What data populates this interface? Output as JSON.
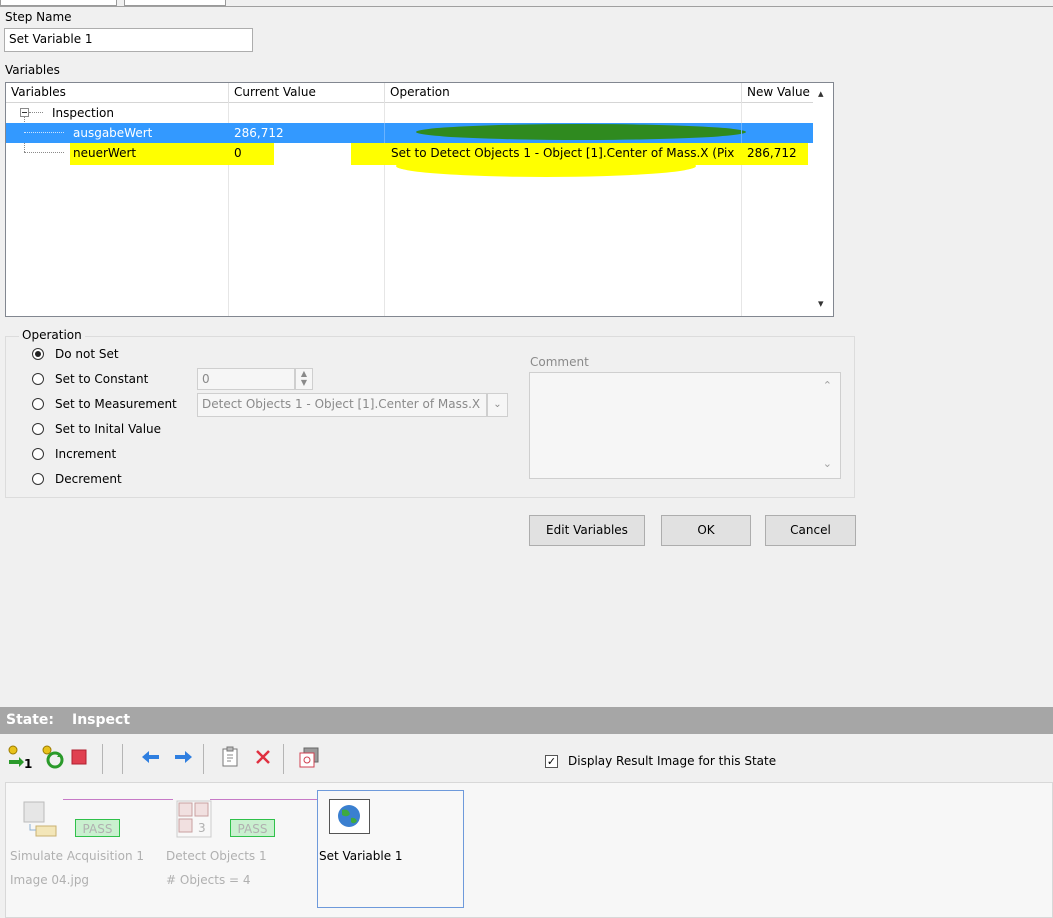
{
  "step_name": {
    "label": "Step Name",
    "value": "Set Variable 1"
  },
  "variables": {
    "label": "Variables",
    "columns": [
      "Variables",
      "Current Value",
      "Operation",
      "New Value"
    ],
    "group": "Inspection",
    "rows": [
      {
        "name": "ausgabeWert",
        "current": "286,712",
        "operation": "",
        "new_value": ""
      },
      {
        "name": "neuerWert",
        "current": "0",
        "operation": "Set to Detect Objects 1 - Object [1].Center of Mass.X (Pix",
        "new_value": "286,712"
      }
    ]
  },
  "operation": {
    "label": "Operation",
    "options": [
      "Do not Set",
      "Set to Constant",
      "Set to Measurement",
      "Set to Inital Value",
      "Increment",
      "Decrement"
    ],
    "selected_index": 0,
    "constant_value": "0",
    "measurement_value": "Detect Objects 1 - Object [1].Center of Mass.X",
    "comment_label": "Comment"
  },
  "buttons": {
    "edit_variables": "Edit Variables",
    "ok": "OK",
    "cancel": "Cancel"
  },
  "state": {
    "label": "State:",
    "name": "Inspect",
    "display_result_label": "Display Result Image for this State",
    "display_result_checked": true
  },
  "steps": [
    {
      "title": "Simulate Acquisition 1",
      "detail": "Image 04.jpg",
      "status": "PASS"
    },
    {
      "title": "Detect Objects 1",
      "detail": "# Objects = 4",
      "status": "PASS",
      "badge": "3"
    },
    {
      "title": "Set Variable 1",
      "detail": ""
    }
  ],
  "colors": {
    "selection": "#3399ff",
    "highlight": "#ffff00",
    "pass": "#2fc14a",
    "state_bar": "#a6a6a6"
  }
}
